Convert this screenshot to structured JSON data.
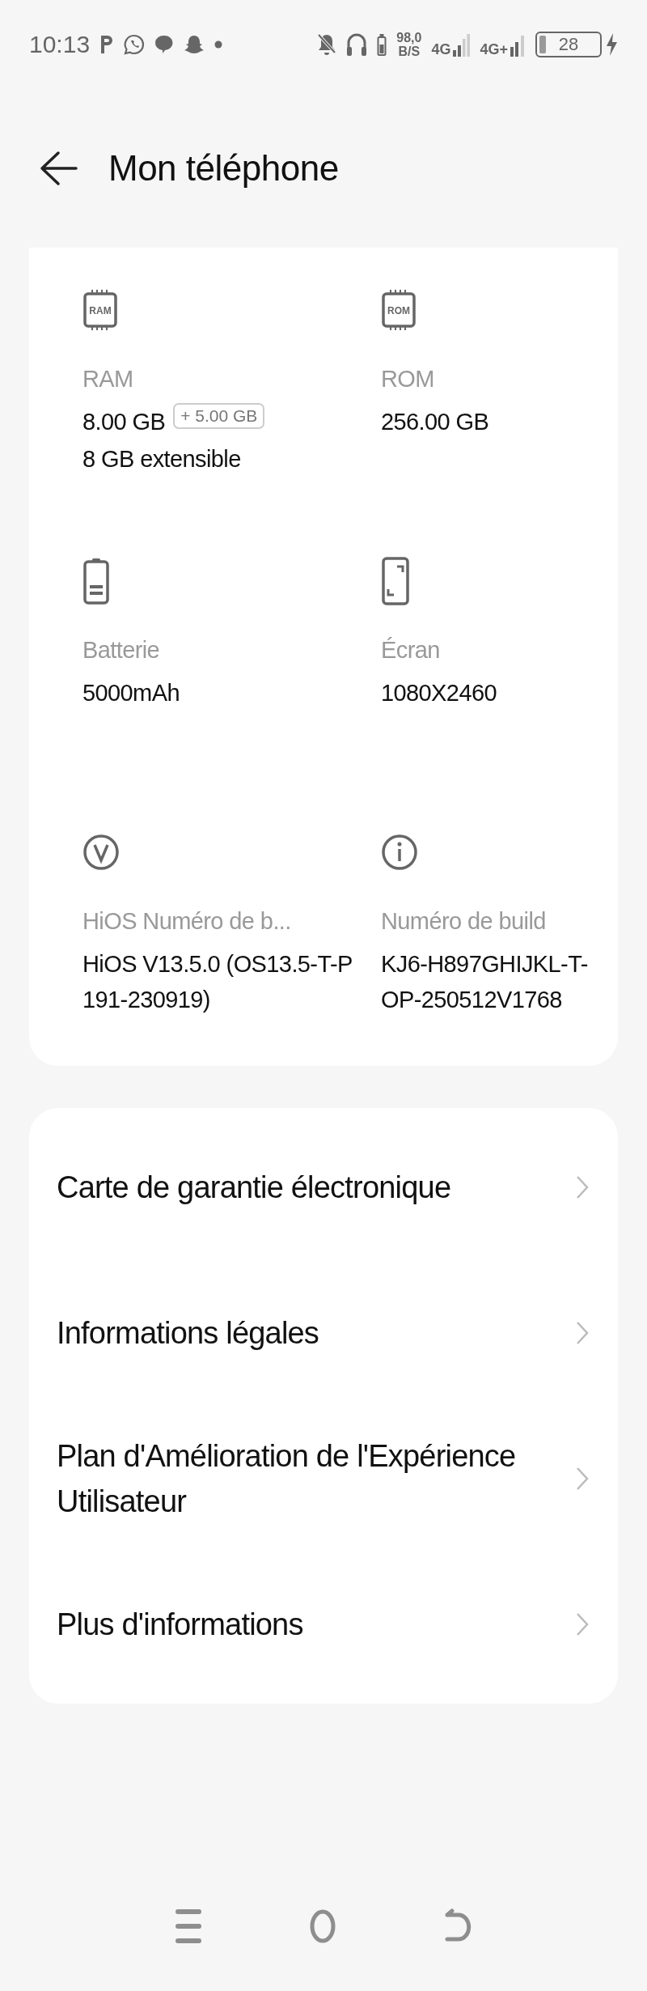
{
  "status_bar": {
    "time": "10:13",
    "network_speed": "98,0",
    "network_speed_unit": "B/S",
    "sim_1": "4G",
    "sim_2": "4G+",
    "battery": "28"
  },
  "header": {
    "title": "Mon téléphone"
  },
  "specs": [
    {
      "kind": "chip",
      "chip_label": "RAM",
      "label": "RAM",
      "value": "8.00 GB",
      "badge": "+ 5.00 GB",
      "note": "8 GB extensible"
    },
    {
      "kind": "chip",
      "chip_label": "ROM",
      "label": "ROM",
      "value": "256.00 GB"
    },
    {
      "kind": "battery",
      "label": "Batterie",
      "value": "5000mAh"
    },
    {
      "kind": "screen",
      "label": "Écran",
      "value": "1080X2460"
    },
    {
      "kind": "version",
      "label": "HiOS Numéro de b...",
      "value": "HiOS V13.5.0 (OS13.5-T-P191-230919)"
    },
    {
      "kind": "info",
      "label": "Numéro de build",
      "value": "KJ6-H897GHIJKL-T-OP-250512V1768"
    }
  ],
  "links": [
    {
      "label": "Carte de garantie électronique"
    },
    {
      "label": "Informations légales"
    },
    {
      "label": "Plan d'Amélioration de l'Expérience Utilisateur"
    },
    {
      "label": "Plus d'informations"
    }
  ]
}
